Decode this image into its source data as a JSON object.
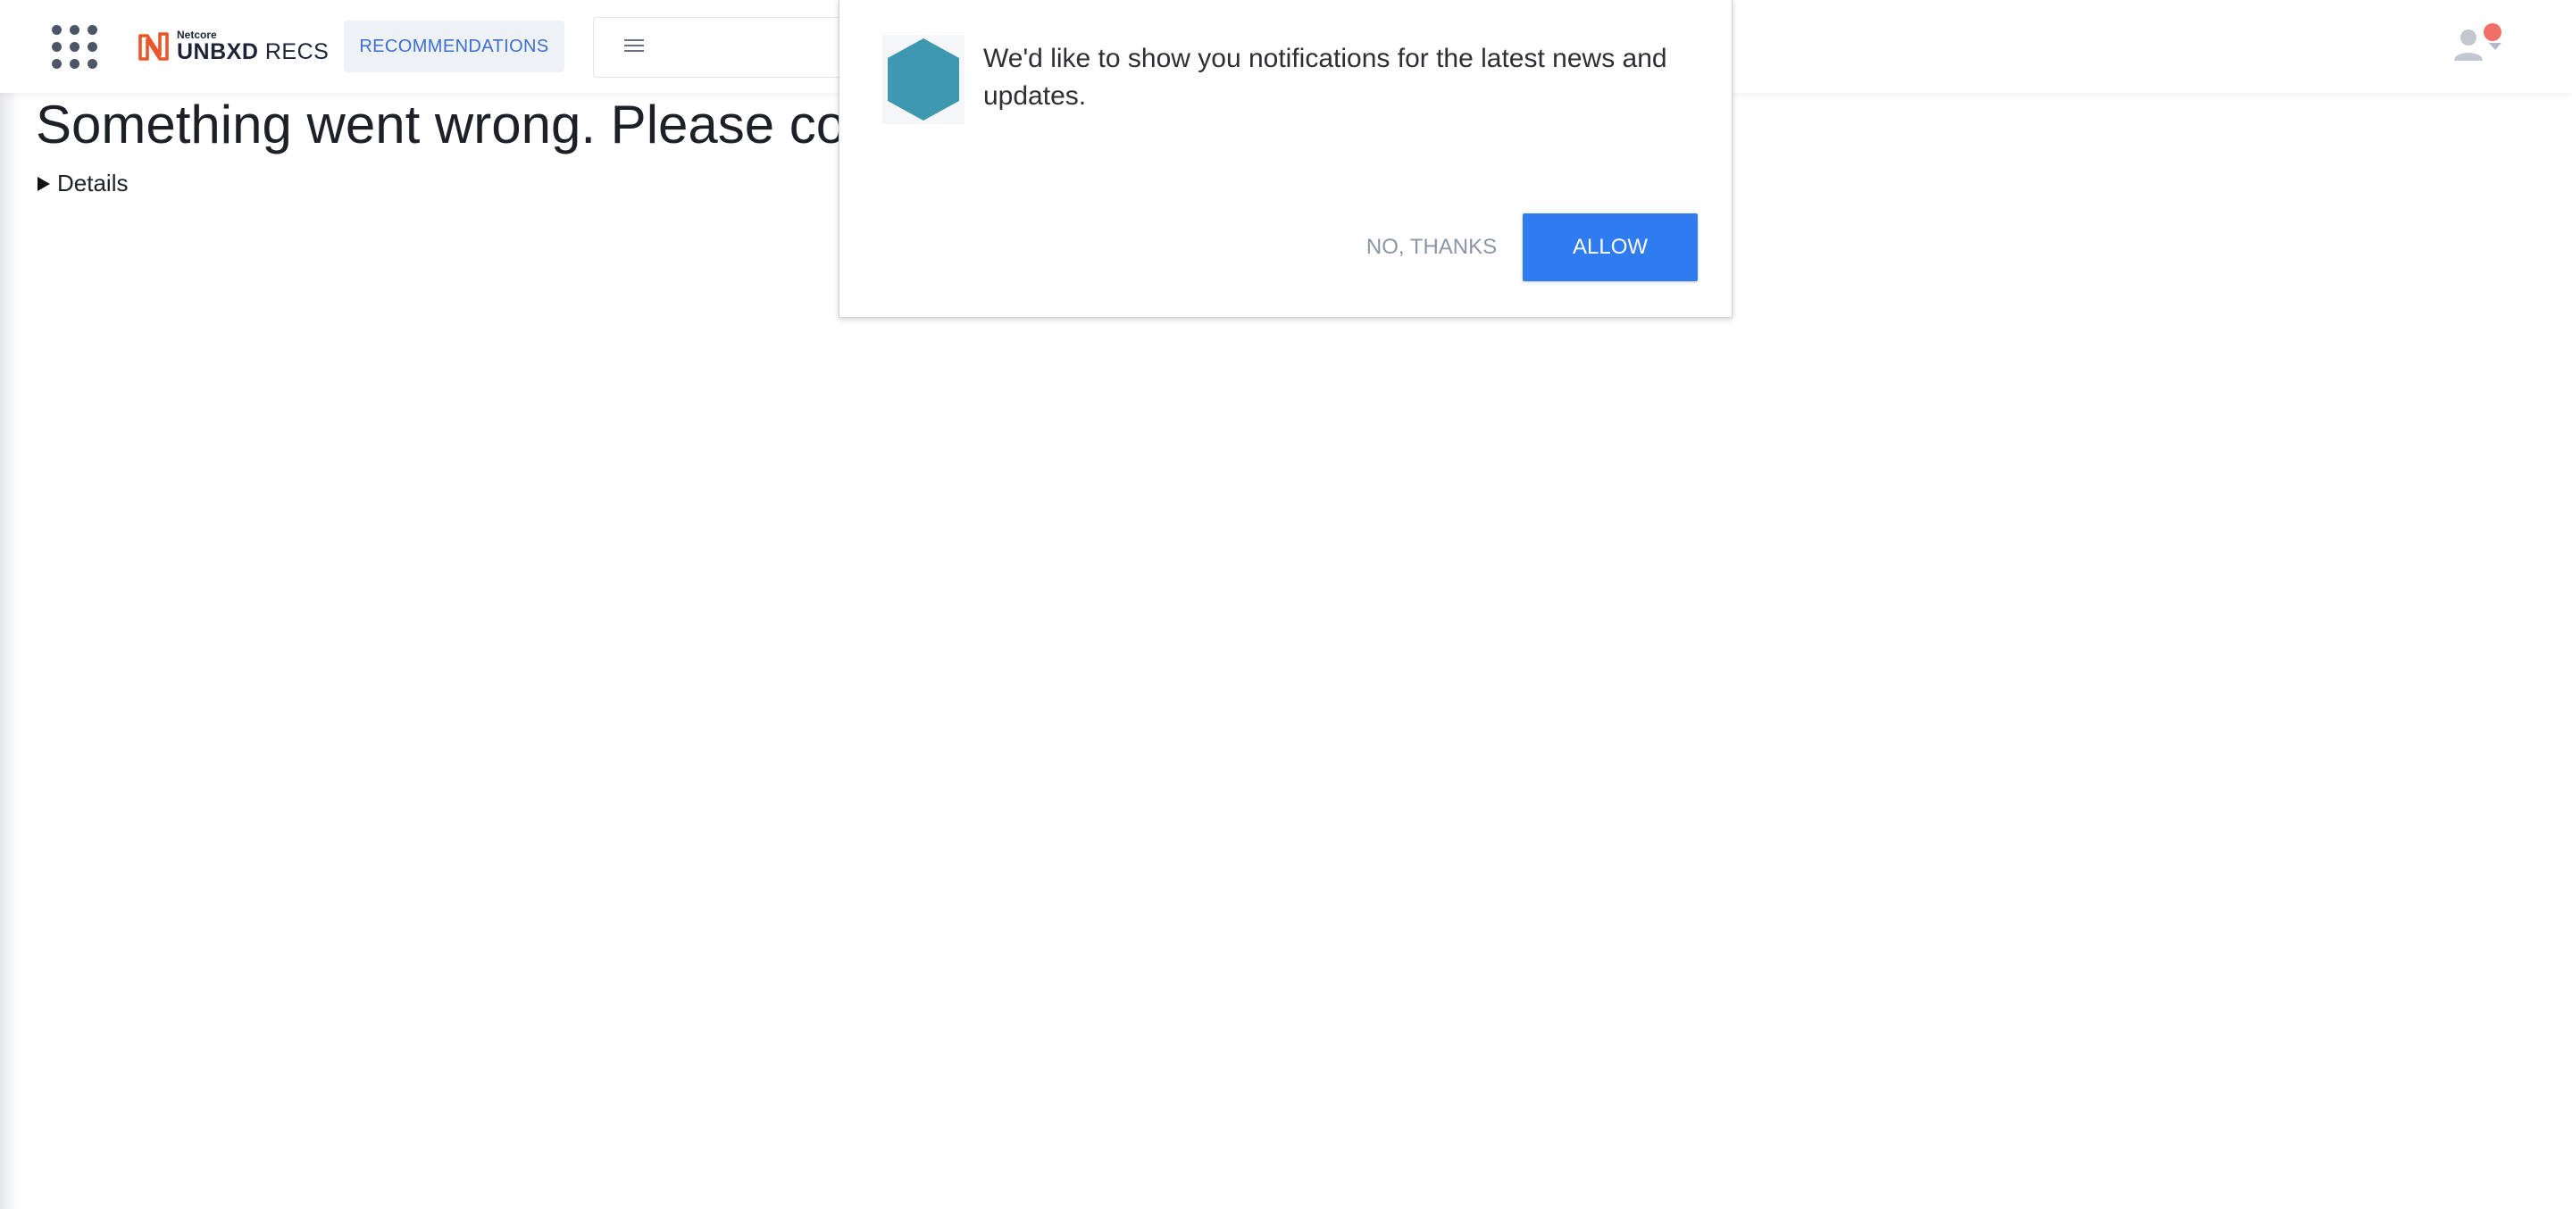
{
  "header": {
    "apps_icon": "grid-dots-icon",
    "logo": {
      "brand_small": "Netcore",
      "brand_bold": "UNBXD",
      "brand_light": " RECS",
      "accent_color": "#e8562a"
    },
    "tab_label": "RECOMMENDATIONS",
    "menu_icon": "hamburger-icon",
    "user_icon": "user-icon",
    "notification_color": "#f07068"
  },
  "main": {
    "error_title": "Something went wrong. Please cont",
    "details_label": "Details"
  },
  "notification_prompt": {
    "icon": "hexagon-icon",
    "message": "We'd like to show you notifications for the latest news and updates.",
    "decline_label": "NO, THANKS",
    "allow_label": "ALLOW",
    "allow_color": "#2f7cf1"
  }
}
